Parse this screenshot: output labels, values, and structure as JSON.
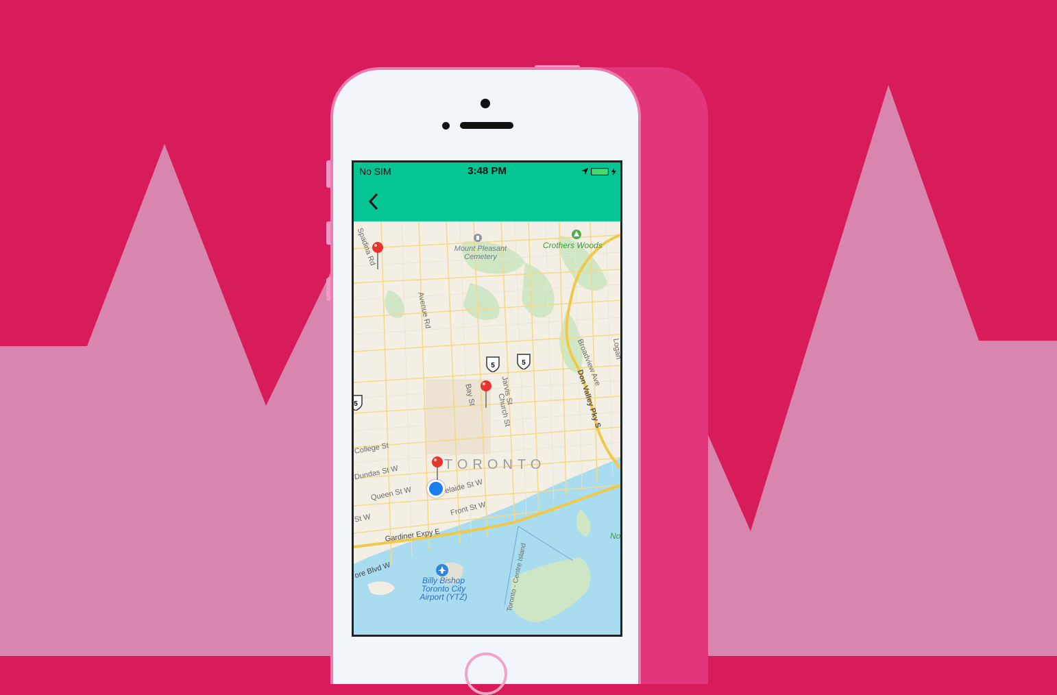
{
  "colors": {
    "background": "#d81b5b",
    "mountains": "#d886ad",
    "appbar": "#05c594",
    "phone_body": "#f0f6fa"
  },
  "status_bar": {
    "carrier": "No SIM",
    "time": "3:48 PM",
    "location_icon": "location-arrow-icon",
    "battery_icon": "battery-icon",
    "charging_icon": "charging-bolt-icon",
    "battery_level": 1.0
  },
  "appbar": {
    "back_icon": "chevron-left-icon"
  },
  "map": {
    "city": "TORONTO",
    "streets": {
      "spadina": "Spadina Rd",
      "avenue": "Avenue Rd",
      "bay": "Bay St",
      "jarvis": "Jarvis St",
      "church": "Church St",
      "broadview": "Broadview Ave",
      "dvp": "Don Valley Pky S",
      "logan": "Logan",
      "college": "College St",
      "dundas": "Dundas St W",
      "queen": "Queen St W",
      "king": "St W",
      "adelaide": "elaide St W",
      "front": "Front St W",
      "gardiner": "Gardiner Expy E",
      "shore": "ore Blvd W",
      "island": "Toronto - Centre Island"
    },
    "pois": {
      "cemetery": "Mount Pleasant Cemetery",
      "woods": "Crothers Woods",
      "airport": "Billy Bishop Toronto City Airport (YTZ)",
      "partial": "No"
    },
    "route_shield": "5",
    "pins_count": 3
  }
}
